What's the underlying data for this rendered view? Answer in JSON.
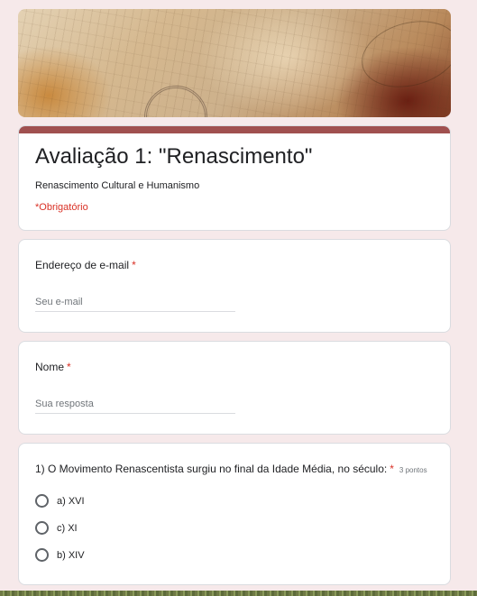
{
  "form": {
    "title": "Avaliação 1: \"Renascimento\"",
    "description": "Renascimento Cultural e Humanismo",
    "required_note": "*Obrigatório",
    "accent_color": "#a0504f",
    "banner_icon": "renaissance-sketch-banner"
  },
  "questions": [
    {
      "label": "Endereço de e-mail",
      "required_marker": "*",
      "placeholder": "Seu e-mail"
    },
    {
      "label": "Nome",
      "required_marker": "*",
      "placeholder": "Sua resposta"
    },
    {
      "label": "1) O Movimento Renascentista surgiu no final da Idade Média, no século:",
      "required_marker": "*",
      "points": "3 pontos",
      "options": [
        "a) XVI",
        "c) XI",
        "b) XIV"
      ]
    }
  ]
}
